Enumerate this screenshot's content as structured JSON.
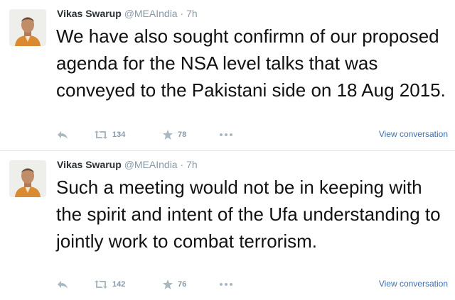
{
  "tweets": [
    {
      "author_name": "Vikas Swarup",
      "handle": "@MEAIndia",
      "separator": "·",
      "time": "7h",
      "text": "We have also sought confirmn of our proposed agenda for the NSA level talks that was conveyed to  the Pakistani side on 18 Aug 2015.",
      "retweets": "134",
      "favorites": "78",
      "view_conversation": "View conversation"
    },
    {
      "author_name": "Vikas Swarup",
      "handle": "@MEAIndia",
      "separator": "·",
      "time": "7h",
      "text": "Such a meeting would not be in keeping with the spirit and intent of the Ufa understanding to jointly work to combat terrorism.",
      "retweets": "142",
      "favorites": "76",
      "view_conversation": "View conversation"
    }
  ],
  "icons": {
    "reply": "reply-icon",
    "retweet": "retweet-icon",
    "favorite": "star-icon",
    "more": "more-icon"
  },
  "colors": {
    "icon_gray": "#aab8c2",
    "link_blue": "#3b6fb6",
    "muted_text": "#8899a6"
  }
}
